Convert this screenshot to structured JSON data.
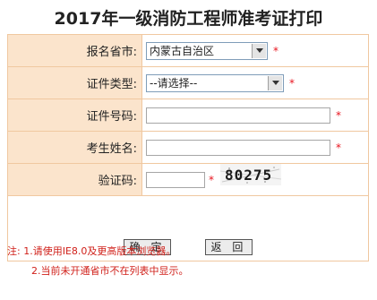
{
  "title": "2017年一级消防工程师准考证打印",
  "form": {
    "province": {
      "label": "报名省市:",
      "value": "内蒙古自治区",
      "required": "*"
    },
    "id_type": {
      "label": "证件类型:",
      "value": "--请选择--",
      "required": "*"
    },
    "id_number": {
      "label": "证件号码:",
      "value": "",
      "required": "*"
    },
    "name": {
      "label": "考生姓名:",
      "value": "",
      "required": "*"
    },
    "captcha": {
      "label": "验证码:",
      "value": "",
      "image_text": "80275",
      "required": "*"
    }
  },
  "buttons": {
    "confirm": "确 定",
    "back": "返 回"
  },
  "notes": [
    "注: 1.请使用IE8.0及更高版本浏览器。",
    "2.当前未开通省市不在列表中显示。"
  ],
  "colors": {
    "label_bg": "#fbe4cc",
    "border": "#f0c8a0",
    "required": "#e8141e",
    "note": "#d0201a"
  }
}
